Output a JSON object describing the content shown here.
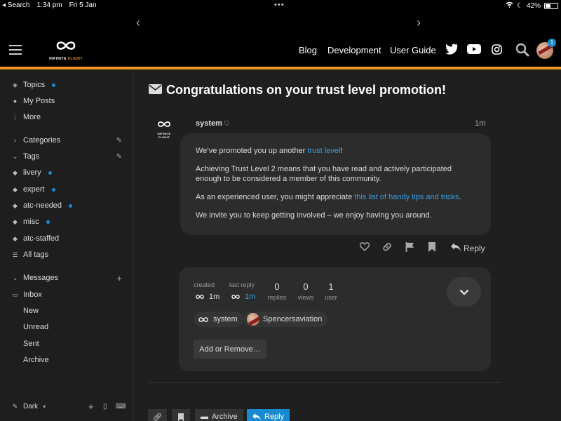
{
  "status_bar": {
    "back_app": "◂ Search",
    "time": "1:34 pm",
    "date": "Fri 5 Jan",
    "battery": "42%"
  },
  "header": {
    "logo_text_a": "INFINITE ",
    "logo_text_b": "FLIGHT",
    "nav": [
      "Blog",
      "Development",
      "User Guide"
    ],
    "notification_count": "1"
  },
  "sidebar": {
    "top": [
      "Topics",
      "My Posts",
      "More"
    ],
    "categories": "Categories",
    "tags_header": "Tags",
    "tags": [
      "livery",
      "expert",
      "atc-needed",
      "misc",
      "atc-staffed"
    ],
    "all_tags": "All tags",
    "messages_header": "Messages",
    "messages": [
      "Inbox",
      "New",
      "Unread",
      "Sent",
      "Archive"
    ],
    "theme_label": "Dark"
  },
  "topic": {
    "title": "Congratulations on your trust level promotion!",
    "author": "system",
    "author_logo_text": "INFINITE FLIGHT",
    "time": "1m",
    "p1_before": "We’ve promoted you up another ",
    "p1_link": "trust level",
    "p1_after": "!",
    "p2": "Achieving Trust Level 2 means that you have read and actively participated enough to be considered a member of this community.",
    "p3_before": "As an experienced user, you might appreciate ",
    "p3_link": "this list of handy tips and tricks",
    "p3_after": ".",
    "p4": "We invite you to keep getting involved – we enjoy having you around.",
    "reply_label": "Reply"
  },
  "meta": {
    "created_label": "created",
    "created_val": "1m",
    "last_reply_label": "last reply",
    "last_reply_val": "1m",
    "replies_num": "0",
    "replies_label": "replies",
    "views_num": "0",
    "views_label": "views",
    "users_num": "1",
    "users_label": "user",
    "participants": [
      "system",
      "Spencersaviation"
    ],
    "add_remove": "Add or Remove…"
  },
  "footer_buttons": {
    "archive": "Archive",
    "reply": "Reply"
  },
  "colors": {
    "accent_orange": "#f0961e",
    "link_blue": "#3a9ee0",
    "unread_dot": "#1a8ad0"
  }
}
